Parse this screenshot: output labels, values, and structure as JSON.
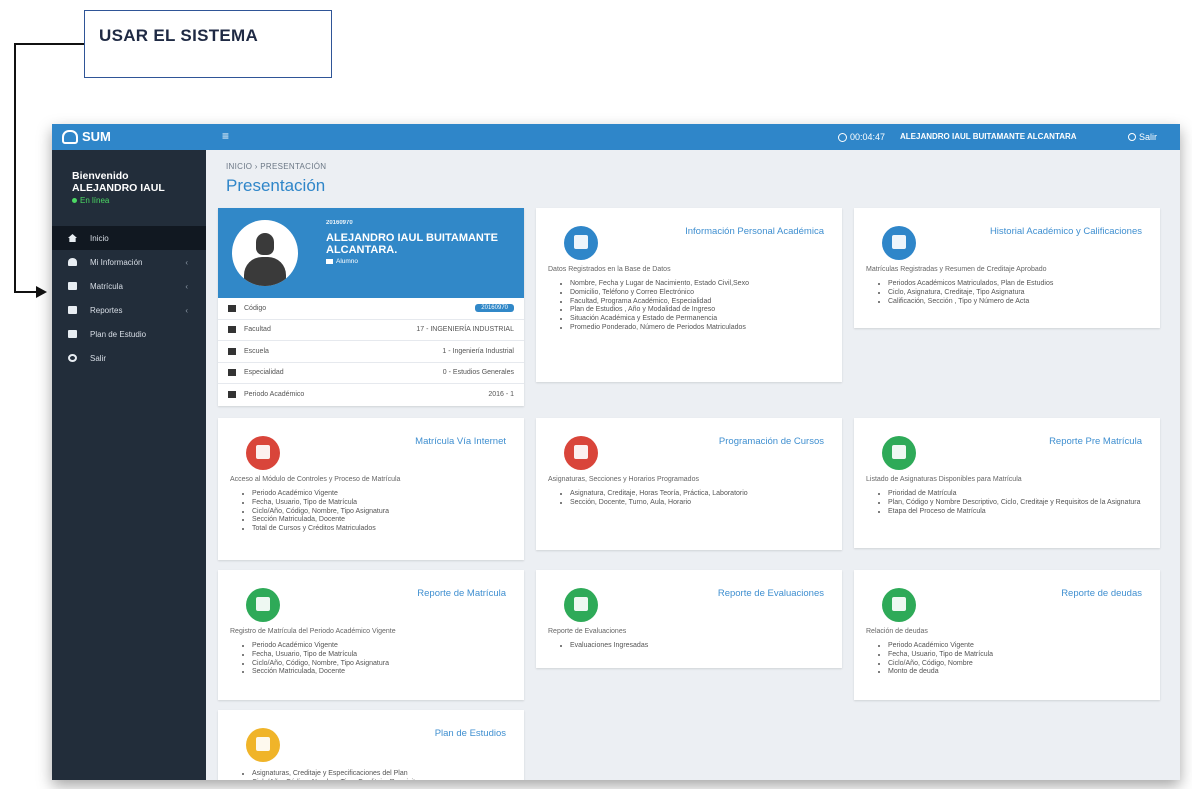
{
  "callout": {
    "label": "USAR EL SISTEMA"
  },
  "topbar": {
    "logo": "SUM",
    "menu_icon": "hamburger-icon",
    "clock": "00:04:47",
    "user": "ALEJANDRO IAUL BUITAMANTE ALCANTARA",
    "logout": "Salir"
  },
  "sidebar": {
    "welcome": "Bienvenido",
    "name": "ALEJANDRO IAUL",
    "status": "En línea",
    "items": [
      {
        "label": "Inicio",
        "icon": "home-icon",
        "chevron": ""
      },
      {
        "label": "Mi Información",
        "icon": "user-icon",
        "chevron": "‹"
      },
      {
        "label": "Matrícula",
        "icon": "edit-icon",
        "chevron": "‹"
      },
      {
        "label": "Reportes",
        "icon": "report-icon",
        "chevron": "‹"
      },
      {
        "label": "Plan de Estudio",
        "icon": "list-icon",
        "chevron": ""
      },
      {
        "label": "Salir",
        "icon": "power-icon",
        "chevron": ""
      }
    ]
  },
  "main": {
    "breadcrumb": "INICIO  ›  PRESENTACIÓN",
    "title": "Presentación"
  },
  "profile": {
    "code": "20160970",
    "name": "ALEJANDRO IAUL BUITAMANTE ALCANTARA.",
    "role": "Alumno",
    "rows": [
      {
        "label": "Código",
        "value": "20160970"
      },
      {
        "label": "Facultad",
        "value": "17 - INGENIERÍA INDUSTRIAL"
      },
      {
        "label": "Escuela",
        "value": "1 - Ingeniería Industrial"
      },
      {
        "label": "Especialidad",
        "value": "0 - Estudios Generales"
      },
      {
        "label": "Periodo Académico",
        "value": "2016 - 1"
      }
    ]
  },
  "cards": [
    {
      "title": "Información Personal Académica",
      "icon": "user-circle-icon",
      "color": "#2f86c9",
      "subtitle": "Datos Registrados en la Base de Datos",
      "items": [
        "Nombre, Fecha y Lugar de Nacimiento, Estado Civil,Sexo",
        "Domicilio, Teléfono y Correo Electrónico",
        "Facultad, Programa Académico, Especialidad",
        "Plan de Estudios , Año y Modalidad de Ingreso",
        "Situación Académica y Estado de Permanencia",
        "Promedio Ponderado, Número de Periodos Matriculados"
      ]
    },
    {
      "title": "Historial Académico y Calificaciones",
      "icon": "chart-icon",
      "color": "#2f86c9",
      "subtitle": "Matrículas Registradas y Resumen de Creditaje Aprobado",
      "items": [
        "Periodos Académicos Matriculados, Plan de Estudios",
        "Ciclo, Asignatura, Creditaje, Tipo Asignatura",
        "Calificación, Sección , Tipo y Número de Acta"
      ]
    },
    {
      "title": "Matrícula Vía Internet",
      "icon": "globe-icon",
      "color": "#d9453a",
      "subtitle": "Acceso al Módulo de Controles y Proceso de Matrícula",
      "items": [
        "Periodo Académico Vigente",
        "Fecha, Usuario, Tipo de Matrícula",
        "Ciclo/Año, Código, Nombre, Tipo Asignatura",
        "Sección Matriculada, Docente",
        "Total de Cursos y Créditos Matriculados"
      ]
    },
    {
      "title": "Programación de Cursos",
      "icon": "calendar-icon",
      "color": "#d9453a",
      "subtitle": "Asignaturas, Secciones y Horarios Programados",
      "items": [
        "Asignatura, Creditaje, Horas Teoría, Práctica, Laboratorio",
        "Sección, Docente, Turno, Aula, Horario"
      ]
    },
    {
      "title": "Reporte Pre Matrícula",
      "icon": "file-icon",
      "color": "#2eaa58",
      "subtitle": "Listado de Asignaturas Disponibles para Matrícula",
      "items": [
        "Prioridad de Matrícula",
        "Plan, Código y Nombre Descriptivo, Ciclo, Creditaje y Requisitos de la Asignatura",
        "Etapa del Proceso de Matrícula"
      ]
    },
    {
      "title": "Reporte de Matrícula",
      "icon": "document-icon",
      "color": "#2eaa58",
      "subtitle": "Registro de Matrícula del Periodo Académico Vigente",
      "items": [
        "Periodo Académico Vigente",
        "Fecha, Usuario, Tipo de Matrícula",
        "Ciclo/Año, Código, Nombre, Tipo Asignatura",
        "Sección Matriculada, Docente"
      ]
    },
    {
      "title": "Reporte de Evaluaciones",
      "icon": "folder-icon",
      "color": "#2eaa58",
      "subtitle": "Reporte de Evaluaciones",
      "items": [
        "Evaluaciones Ingresadas"
      ]
    },
    {
      "title": "Reporte de deudas",
      "icon": "money-icon",
      "color": "#2eaa58",
      "subtitle": "Relación de deudas",
      "items": [
        "Periodo Académico Vigente",
        "Fecha, Usuario, Tipo de Matrícula",
        "Ciclo/Año, Código, Nombre",
        "Monto de deuda"
      ]
    },
    {
      "title": "Plan de Estudios",
      "icon": "table-icon",
      "color": "#f0b429",
      "subtitle": "",
      "items": [
        "Asignaturas, Creditaje y Especificaciones del Plan",
        "Ciclo/Año, Código, Nombre, Tipo, Creditaje, Requisitos"
      ]
    }
  ]
}
